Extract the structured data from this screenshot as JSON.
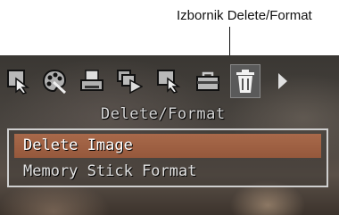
{
  "callout": {
    "label": "Izbornik Delete/Format"
  },
  "iconbar": {
    "icons": [
      "magnify-cursor-icon",
      "palette-icon",
      "print-icon",
      "slideshow-icon",
      "rotate-cursor-icon",
      "toolbox-icon",
      "trash-icon",
      "arrow-right-icon"
    ],
    "active_icon": "trash-icon"
  },
  "menu": {
    "title": "Delete/Format",
    "items": [
      {
        "label": "Delete Image",
        "selected": true
      },
      {
        "label": "Memory Stick Format",
        "selected": false
      }
    ]
  },
  "colors": {
    "selected_bg": "#9b5e40",
    "frame": "#cfcfcf",
    "text": "#e2e2e2"
  }
}
